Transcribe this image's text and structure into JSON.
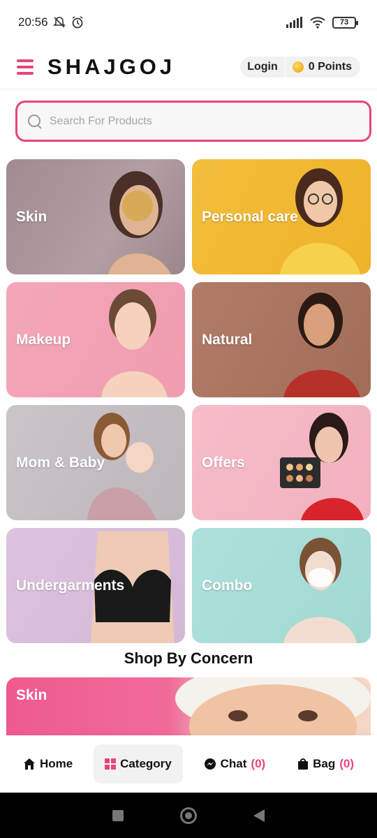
{
  "status_bar": {
    "time": "20:56",
    "battery": "73"
  },
  "header": {
    "brand": "SHAJGOJ",
    "login_label": "Login",
    "points_label": "0 Points"
  },
  "search": {
    "placeholder": "Search For Products"
  },
  "categories": [
    {
      "label": "Skin",
      "color": "#a89398"
    },
    {
      "label": "Personal care",
      "color": "#f0b631"
    },
    {
      "label": "Makeup",
      "color": "#f1a4b5"
    },
    {
      "label": "Natural",
      "color": "#a87360"
    },
    {
      "label": "Mom & Baby",
      "color": "#c8c2c7"
    },
    {
      "label": "Offers",
      "color": "#f4b7c4"
    },
    {
      "label": "Undergarments",
      "color": "#dbc1dd"
    },
    {
      "label": "Combo",
      "color": "#a8ddd8"
    }
  ],
  "concern": {
    "title": "Shop By Concern",
    "banner_label": "Skin"
  },
  "bottom_nav": {
    "home": "Home",
    "category": "Category",
    "chat": "Chat",
    "chat_count": "(0)",
    "bag": "Bag",
    "bag_count": "(0)"
  },
  "colors": {
    "accent": "#e8457a"
  }
}
